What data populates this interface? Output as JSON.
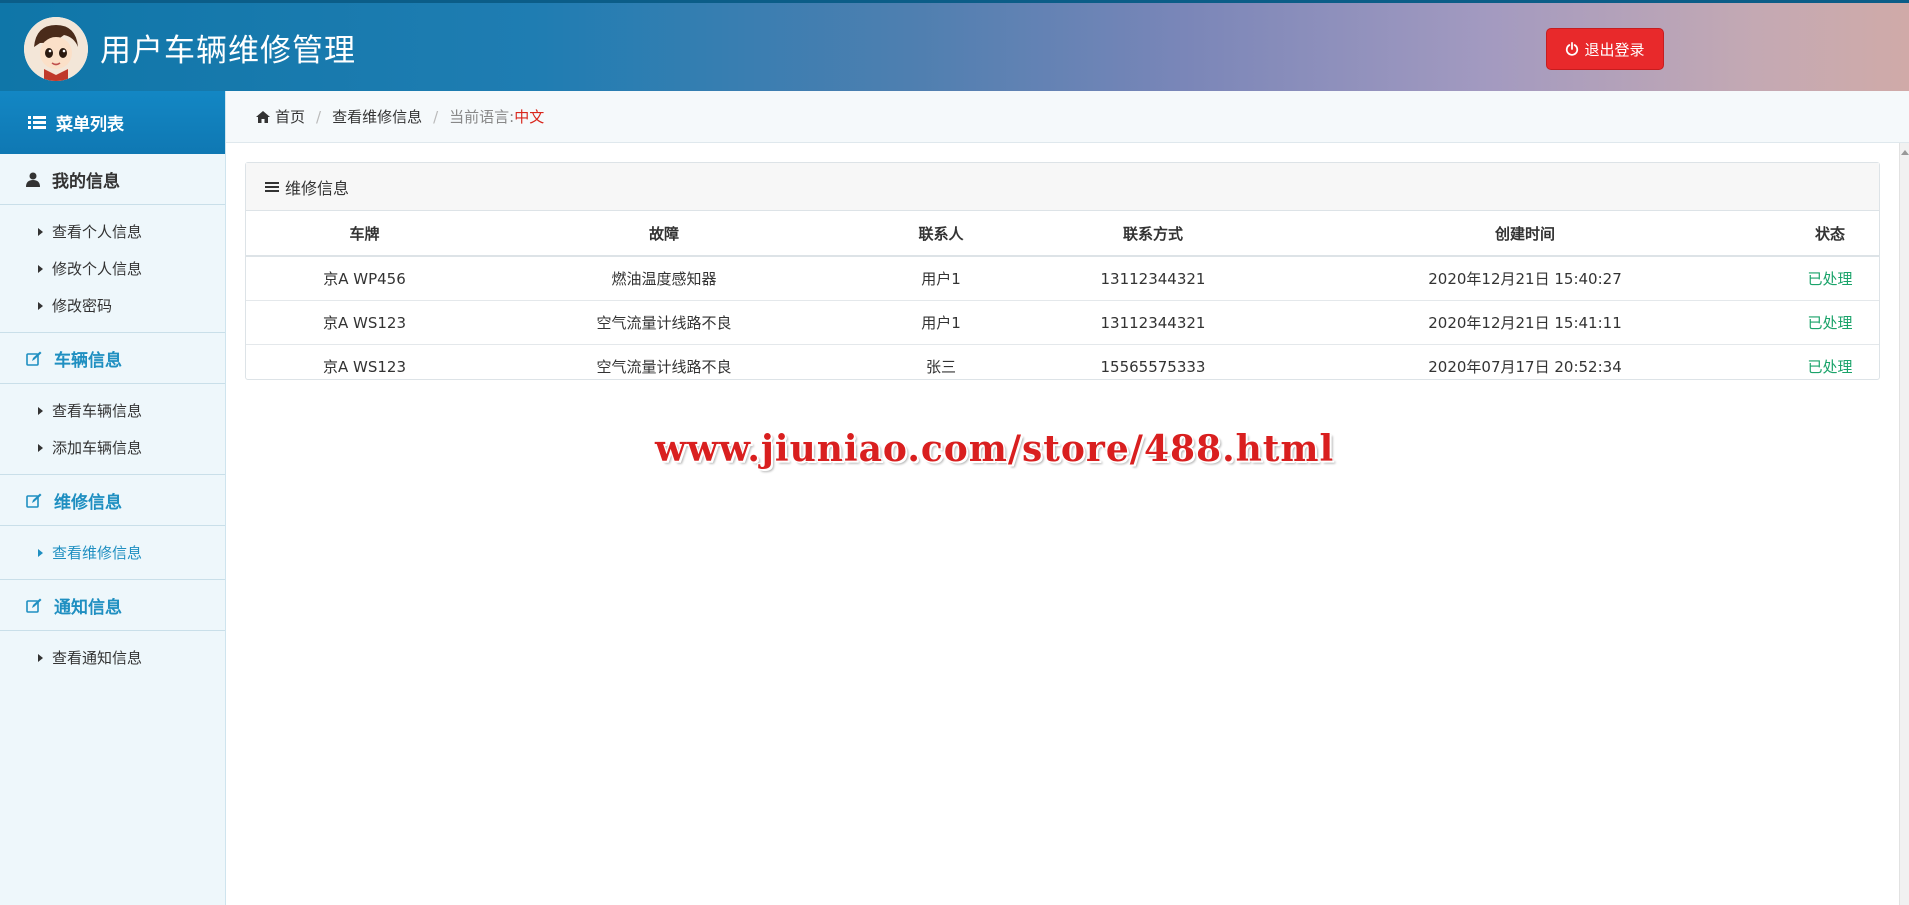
{
  "header": {
    "title": "用户车辆维修管理",
    "logout_label": "退出登录",
    "logout_color": "#e8292b"
  },
  "sidebar": {
    "menu_title": "菜单列表",
    "groups": [
      {
        "title": "我的信息",
        "items": [
          "查看个人信息",
          "修改个人信息",
          "修改密码"
        ]
      },
      {
        "title": "车辆信息",
        "items": [
          "查看车辆信息",
          "添加车辆信息"
        ]
      },
      {
        "title": "维修信息",
        "items": [
          "查看维修信息"
        ]
      },
      {
        "title": "通知信息",
        "items": [
          "查看通知信息"
        ]
      }
    ]
  },
  "breadcrumb": {
    "home": "首页",
    "current": "查看维修信息",
    "lang_label": "当前语言:",
    "lang_value": "中文"
  },
  "panel": {
    "title": "维修信息",
    "columns": [
      "车牌",
      "故障",
      "联系人",
      "联系方式",
      "创建时间",
      "状态"
    ],
    "rows": [
      [
        "京A WP456",
        "燃油温度感知器",
        "用户1",
        "13112344321",
        "2020年12月21日 15:40:27",
        "已处理"
      ],
      [
        "京A WS123",
        "空气流量计线路不良",
        "用户1",
        "13112344321",
        "2020年12月21日 15:41:11",
        "已处理"
      ],
      [
        "京A WS123",
        "空气流量计线路不良",
        "张三",
        "15565575333",
        "2020年07月17日 20:52:34",
        "已处理"
      ]
    ]
  },
  "watermark": "www.jiuniao.com/store/488.html",
  "colors": {
    "accent": "#1f8fc1",
    "status_done": "#1aa36a",
    "lang_highlight": "#d9261c"
  }
}
